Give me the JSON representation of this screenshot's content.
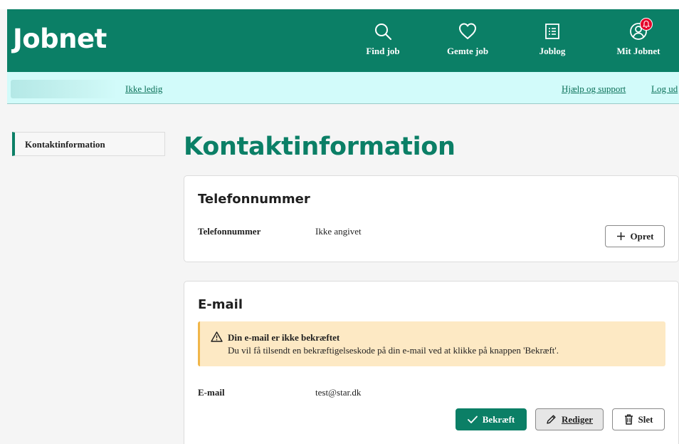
{
  "header": {
    "logo": "Jobnet",
    "nav": [
      {
        "label": "Find job",
        "icon": "search-icon"
      },
      {
        "label": "Gemte job",
        "icon": "heart-icon"
      },
      {
        "label": "Joblog",
        "icon": "list-icon"
      },
      {
        "label": "Mit Jobnet",
        "icon": "user-icon"
      }
    ]
  },
  "subbar": {
    "status_link": "Ikke ledig",
    "help_link": "Hjælp og support",
    "logout_link": "Log ud"
  },
  "sidebar": {
    "items": [
      {
        "label": "Kontaktinformation",
        "active": true
      }
    ]
  },
  "main": {
    "title": "Kontaktinformation",
    "phone_card": {
      "title": "Telefonnummer",
      "field_label": "Telefonnummer",
      "field_value": "Ikke angivet",
      "create_button": "Opret"
    },
    "email_card": {
      "title": "E-mail",
      "alert_title": "Din e-mail er ikke bekræftet",
      "alert_text": "Du vil få tilsendt en bekræftigelseskode på din e-mail ved at klikke på knappen 'Bekræft'.",
      "field_label": "E-mail",
      "field_value": "test@star.dk",
      "confirm_button": "Bekræft",
      "edit_button": "Rediger",
      "delete_button": "Slet"
    }
  },
  "colors": {
    "brand_green": "#0b7f66",
    "subbar_bg": "#d2fbfa",
    "alert_bg": "#fde9c4",
    "alert_border": "#f0b649",
    "badge_red": "#e4062b"
  }
}
